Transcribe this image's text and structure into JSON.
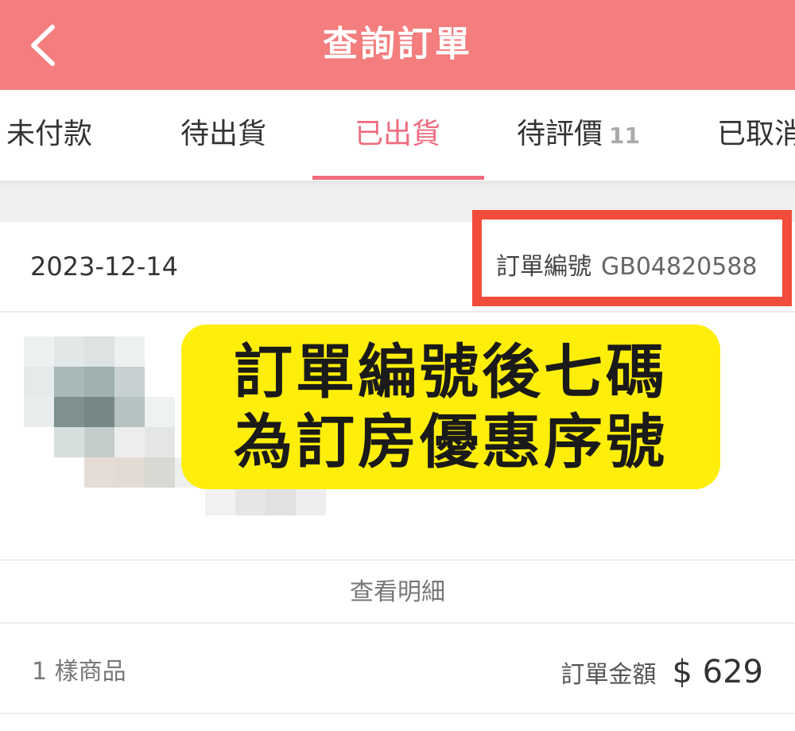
{
  "header": {
    "title": "查詢訂單",
    "back_icon": "chevron-left-icon"
  },
  "tabs": [
    {
      "label": "未付款",
      "count": ""
    },
    {
      "label": "待出貨",
      "count": ""
    },
    {
      "label": "已出貨",
      "count": "",
      "active": true
    },
    {
      "label": "待評價",
      "count": "11"
    },
    {
      "label": "已取消",
      "count": ""
    }
  ],
  "order": {
    "date": "2023-12-14",
    "id_label": "訂單編號",
    "id_value": "GB04820588",
    "detail_label": "查看明細",
    "items_count": "1 樣商品",
    "amount_label": "訂單金額",
    "amount_value": "$ 629"
  },
  "callout": {
    "line1": "訂單編號後七碼",
    "line2": "為訂房優惠序號"
  },
  "colors": {
    "header": "#f47d7d",
    "active_tab": "#f06b7e",
    "highlight_border": "#f24c3b",
    "callout_bg": "#ffee0a"
  }
}
